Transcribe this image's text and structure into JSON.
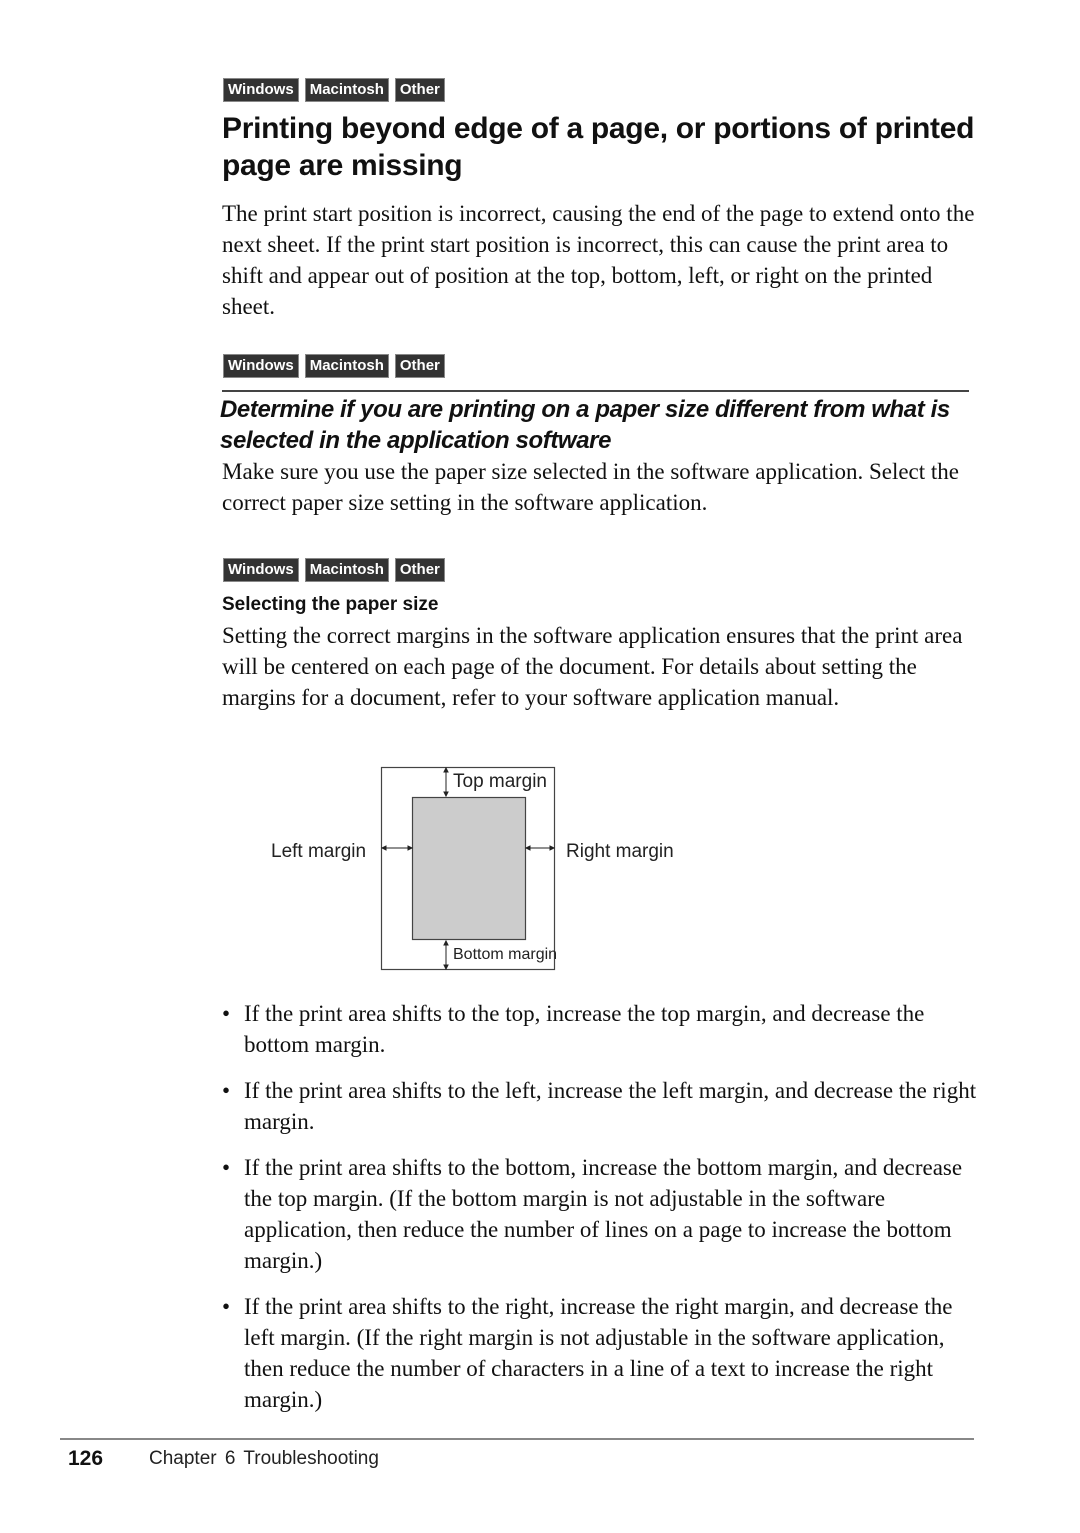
{
  "platform_badges": [
    "Windows",
    "Macintosh",
    "Other"
  ],
  "section": {
    "title": "Printing beyond edge of a page, or portions of printed page are missing",
    "intro": "The print start position is incorrect, causing the end of the page to extend onto the next sheet. If the print start position is incorrect, this can cause the print area to shift and appear out of position at the top, bottom, left, or right on the printed sheet."
  },
  "subsection": {
    "title": "Determine if you are printing on a paper size different from what is selected in the application software",
    "body": "Make sure you use the paper size selected in the software application. Select the correct paper size setting in the software application."
  },
  "paper_size": {
    "title": "Selecting the paper size",
    "body": "Setting the correct margins in the software application ensures that the print area will be centered on each page of the document. For details about setting the margins for a document, refer to your software application manual."
  },
  "diagram": {
    "top": "Top margin",
    "left": "Left margin",
    "right": "Right margin",
    "bottom": "Bottom margin"
  },
  "bullets": [
    "If the print area shifts to the top, increase the top margin, and decrease the bottom margin.",
    "If the print area shifts to the left, increase the left margin, and decrease the right margin.",
    "If the print area shifts to the bottom, increase the bottom margin, and decrease the top margin. (If the bottom margin is not adjustable in the software application, then reduce the number of lines on a page to increase the bottom margin.)",
    "If the print area shifts to the right, increase the right margin, and decrease the left margin. (If the right margin is not adjustable in the software application, then reduce the number of characters in a line of a text to increase the right margin.)"
  ],
  "bullet_glyph": "•",
  "footer": {
    "page_number": "126",
    "chapter": "Chapter 6   Troubleshooting"
  }
}
